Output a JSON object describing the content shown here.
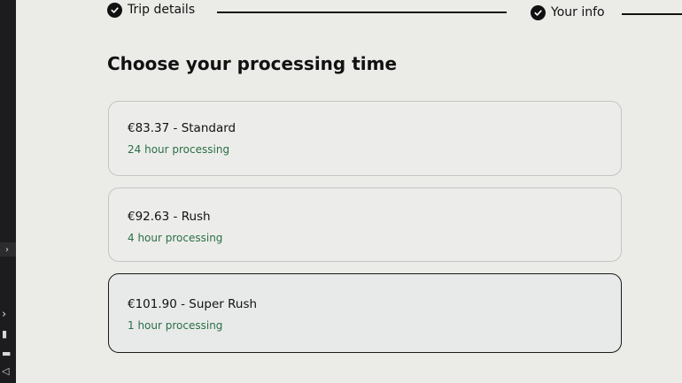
{
  "stepper": {
    "steps": [
      {
        "label": "Trip details",
        "status": "completed",
        "icon": "check-circle-icon"
      },
      {
        "label": "Your info",
        "status": "completed",
        "icon": "check-circle-icon"
      }
    ]
  },
  "page": {
    "title": "Choose your processing time"
  },
  "options": [
    {
      "price_label": "€83.37 - Standard",
      "subtitle": "24 hour processing",
      "selected": false
    },
    {
      "price_label": "€92.63 - Rush",
      "subtitle": "4 hour processing",
      "selected": false
    },
    {
      "price_label": "€101.90 - Super Rush",
      "subtitle": "1 hour processing",
      "selected": true
    }
  ],
  "colors": {
    "background": "#ebebe8",
    "text": "#111111",
    "subtitle_green": "#2b6e47",
    "card_border": "#c5c6c3",
    "selected_border": "#1a1a1a"
  }
}
